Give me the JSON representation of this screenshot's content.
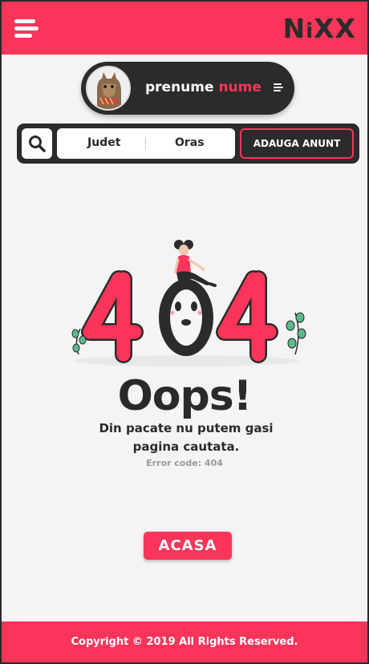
{
  "header": {
    "brand_pre": "N",
    "brand_i": "i",
    "brand_post": "XX",
    "menu_icon": "hamburger-menu-icon"
  },
  "profile": {
    "first_name": "prenume",
    "last_name": "nume",
    "avatar_icon": "cat-avatar",
    "menu_icon": "menu-icon"
  },
  "search": {
    "icon": "search-icon",
    "filters": [
      "Judet",
      "Oras"
    ],
    "add_button": "ADAUGA ANUNT"
  },
  "error": {
    "code_graphic": "404",
    "title": "Oops!",
    "message_line1": "Din pacate nu putem gasi",
    "message_line2": "pagina cautata.",
    "error_code": "Error code: 404"
  },
  "home_button": "ACASA",
  "footer": {
    "copyright": "Copyright © 2019 All Rights Reserved."
  },
  "colors": {
    "accent": "#fb3559",
    "dark": "#2b2b2b",
    "background": "#f4f4f4"
  }
}
